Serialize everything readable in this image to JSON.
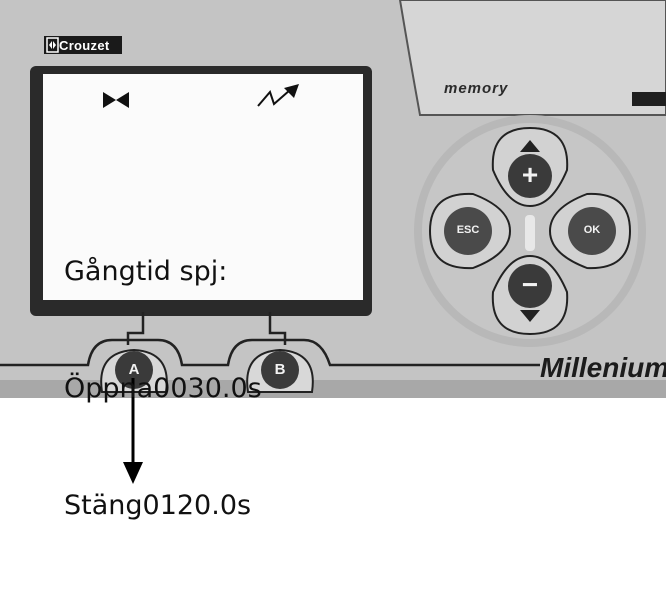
{
  "brand": {
    "name": "Crouzet"
  },
  "cartridge": {
    "label": "memory"
  },
  "model": {
    "name": "Millenium II"
  },
  "lcd": {
    "status_icons": [
      "bowtie-icon",
      "pulse-arrow-icon"
    ],
    "lines": [
      "Gångtid spj:",
      "Öppna0030.0s",
      "Stäng0120.0s"
    ]
  },
  "keypad": {
    "esc_label": "ESC",
    "ok_label": "OK",
    "plus_label": "+",
    "minus_label": "−"
  },
  "function_keys": {
    "a_label": "A",
    "b_label": "B"
  },
  "colors": {
    "panel": "#c9c9c9",
    "lcd_background": "#ffffff",
    "key_dark": "#3a3a3a",
    "text_dark": "#111111"
  }
}
